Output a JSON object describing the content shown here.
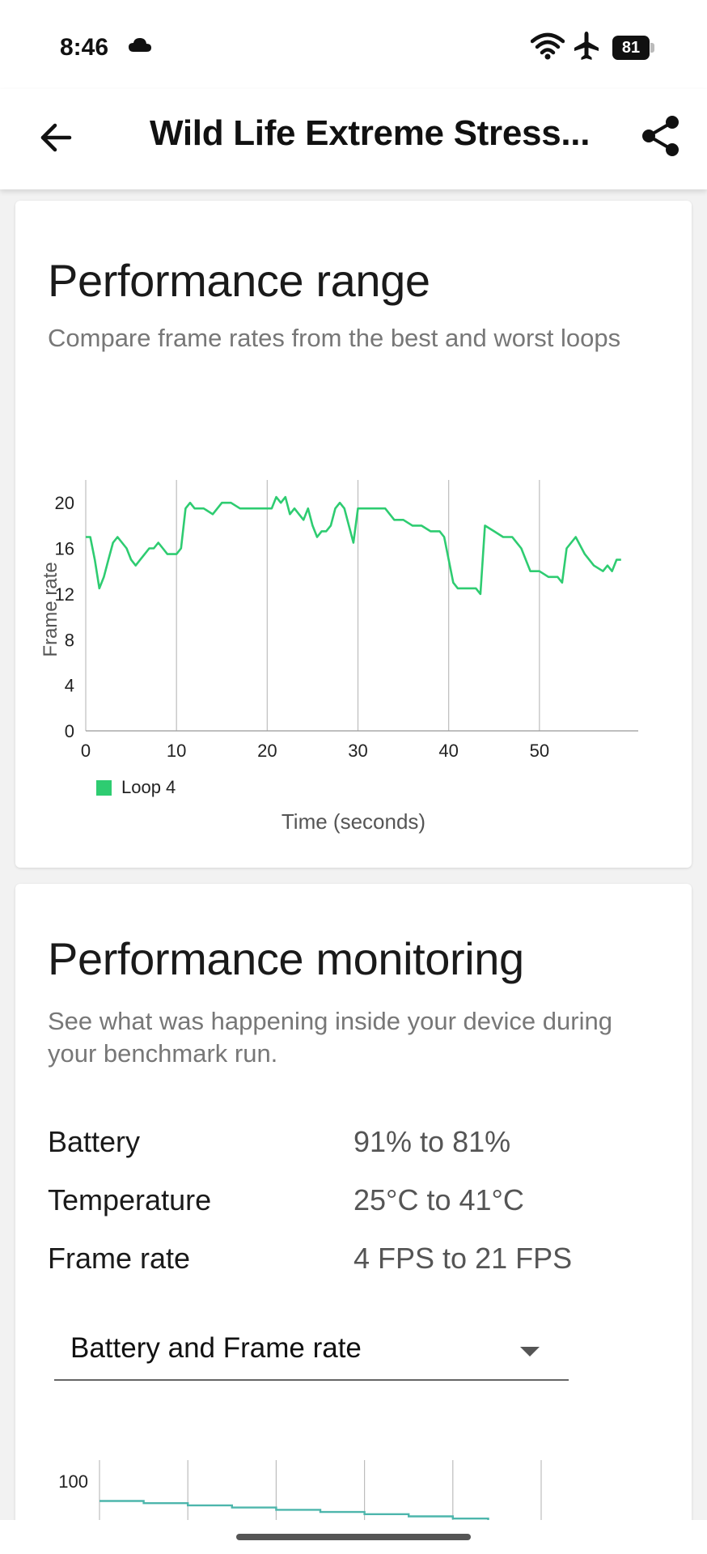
{
  "status_bar": {
    "time": "8:46",
    "battery_level": "81",
    "icons": [
      "cloud-icon",
      "wifi-icon",
      "airplane-icon",
      "battery-icon"
    ]
  },
  "app_bar": {
    "title": "Wild Life Extreme Stress...",
    "back_icon": "arrow-left-icon",
    "share_icon": "share-icon"
  },
  "performance_range": {
    "title": "Performance range",
    "subtitle": "Compare frame rates from the best and worst loops"
  },
  "chart_data": [
    {
      "type": "line",
      "title": "",
      "xlabel": "Time (seconds)",
      "ylabel": "Frame rate",
      "xlim": [
        0,
        60
      ],
      "ylim": [
        0,
        22
      ],
      "x_ticks": [
        "0",
        "10",
        "20",
        "30",
        "40",
        "50"
      ],
      "y_ticks": [
        "0",
        "4",
        "8",
        "12",
        "16",
        "20"
      ],
      "grid": "vertical",
      "legend": "bottom-left",
      "color": "#2ecc71",
      "series": [
        {
          "name": "Loop 4",
          "x": [
            0,
            0.5,
            1,
            1.5,
            2,
            2.5,
            3,
            3.5,
            4,
            4.5,
            5,
            5.5,
            6,
            6.5,
            7,
            7.5,
            8,
            8.5,
            9,
            9.5,
            10,
            10.5,
            11,
            11.5,
            12,
            13,
            14,
            15,
            16,
            17,
            18,
            19,
            20,
            20.5,
            21,
            21.5,
            22,
            22.5,
            23,
            23.5,
            24,
            24.5,
            25,
            25.5,
            26,
            26.5,
            27,
            27.5,
            28,
            28.5,
            29,
            29.5,
            30,
            30.5,
            31,
            31.5,
            32,
            33,
            34,
            35,
            36,
            37,
            38,
            39,
            39.5,
            40,
            40.5,
            41,
            42,
            43,
            43.5,
            44,
            45,
            46,
            47,
            48,
            49,
            49.5,
            50,
            51,
            52,
            52.5,
            53,
            53.5,
            54,
            55,
            56,
            57,
            57.5,
            58,
            58.5,
            59
          ],
          "values": [
            17,
            17,
            15,
            12.5,
            13.5,
            15,
            16.5,
            17,
            16.5,
            16,
            15,
            14.5,
            15,
            15.5,
            16,
            16,
            16.5,
            16,
            15.5,
            15.5,
            15.5,
            16,
            19.5,
            20,
            19.5,
            19.5,
            19,
            20,
            20,
            19.5,
            19.5,
            19.5,
            19.5,
            19.5,
            20.5,
            20,
            20.5,
            19,
            19.5,
            19,
            18.5,
            19.5,
            18,
            17,
            17.5,
            17.5,
            18,
            19.5,
            20,
            19.5,
            18,
            16.5,
            19.5,
            19.5,
            19.5,
            19.5,
            19.5,
            19.5,
            18.5,
            18.5,
            18,
            18,
            17.5,
            17.5,
            17,
            15,
            13,
            12.5,
            12.5,
            12.5,
            12,
            18,
            17.5,
            17,
            17,
            16,
            14,
            14,
            14,
            13.5,
            13.5,
            13,
            16,
            16.5,
            17,
            15.5,
            14.5,
            14,
            14.5,
            14,
            15,
            15
          ]
        }
      ]
    },
    {
      "type": "line",
      "title": "",
      "xlim": [
        0,
        50
      ],
      "ylim": [
        0,
        100
      ],
      "y_ticks": [
        "100"
      ],
      "grid": "vertical",
      "color": "#4db6ac",
      "series": [
        {
          "x": [
            0,
            5,
            10,
            15,
            20,
            25,
            30,
            35,
            40,
            44
          ],
          "values": [
            91,
            90,
            89,
            88,
            87,
            86,
            85,
            84,
            83,
            82
          ]
        }
      ]
    }
  ],
  "performance_monitoring": {
    "title": "Performance monitoring",
    "subtitle": "See what was happening inside your device during your benchmark run.",
    "stats": [
      {
        "label": "Battery",
        "value": "91% to 81%"
      },
      {
        "label": "Temperature",
        "value": "25°C to 41°C"
      },
      {
        "label": "Frame rate",
        "value": "4 FPS to 21 FPS"
      }
    ],
    "dropdown": {
      "value": "Battery and Frame rate",
      "icon": "caret-down-icon"
    }
  }
}
